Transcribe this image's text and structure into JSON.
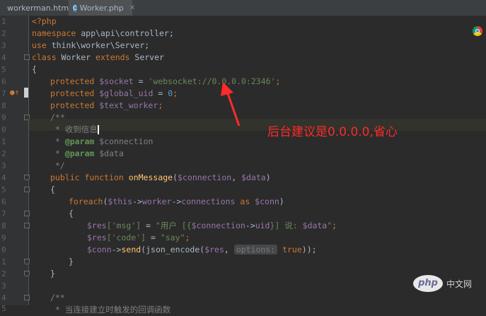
{
  "tabs": [
    {
      "label": "workerman.html",
      "icon": "html-file-icon",
      "active": false
    },
    {
      "label": "Worker.php",
      "icon": "php-file-icon",
      "active": true
    }
  ],
  "line_numbers": [
    "1",
    "2",
    "3",
    "4",
    "5",
    "6",
    "7",
    "8",
    "9",
    "0",
    "1",
    "2",
    "3",
    "4",
    "5",
    "6",
    "7",
    "8",
    "9",
    "0",
    "1",
    "2",
    "3",
    "4",
    "5"
  ],
  "code": {
    "l1": "<?php",
    "l2_kw": "namespace",
    "l2_rest": " app\\api\\controller;",
    "l3_kw": "use",
    "l3_rest": " think\\worker\\Server;",
    "l4_kw1": "class",
    "l4_name": " Worker ",
    "l4_kw2": "extends",
    "l4_name2": " Server",
    "l5": "{",
    "l6_kw": "protected",
    "l6_var": " $socket",
    "l6_eq": " = ",
    "l6_str": "'websocket://0.0.0.0:2346'",
    "l6_end": ";",
    "l7_kw": "protected",
    "l7_var": " $global_uid",
    "l7_eq": " = ",
    "l7_num": "0",
    "l7_end": ";",
    "l8_kw": "protected",
    "l8_var": " $text_worker",
    "l8_end": ";",
    "l9": "/**",
    "l10": " * 收到信息",
    "l11_star": " * ",
    "l11_tag": "@param",
    "l11_arg": " $connection",
    "l12_star": " * ",
    "l12_tag": "@param",
    "l12_arg": " $data",
    "l13": " */",
    "l14_kw1": "public",
    "l14_kw2": " function",
    "l14_fn": " onMessage",
    "l14_p1": "(",
    "l14_v1": "$connection",
    "l14_c": ", ",
    "l14_v2": "$data",
    "l14_p2": ")",
    "l15": "{",
    "l16_kw": "foreach",
    "l16_p": "(",
    "l16_v1": "$this",
    "l16_a1": "->",
    "l16_f1": "worker",
    "l16_a2": "->",
    "l16_f2": "connections",
    "l16_as": " as ",
    "l16_v2": "$conn",
    "l16_end": ")",
    "l17": "{",
    "l18_v": "$res",
    "l18_k": "['msg']",
    "l18_eq": " = ",
    "l18_s1": "\"用户 [{",
    "l18_v2": "$connection",
    "l18_a": "->",
    "l18_f": "uid",
    "l18_s2": "}] 说: ",
    "l18_v3": "$data",
    "l18_s3": "\"",
    "l18_end": ";",
    "l19_v": "$res",
    "l19_k": "['code']",
    "l19_eq": " = ",
    "l19_s": "\"say\"",
    "l19_end": ";",
    "l20_v": "$conn",
    "l20_a": "->",
    "l20_f": "send",
    "l20_p": "(json_encode(",
    "l20_v2": "$res",
    "l20_c": ", ",
    "l20_hint": "options:",
    "l20_kw": " true",
    "l20_end": "));",
    "l21": "}",
    "l22": "}",
    "l24": "/**",
    "l25": " * 当连接建立时触发的回调函数"
  },
  "annotation": "后台建议是0.0.0.0,省心",
  "watermark": {
    "logo": "php",
    "text": "中文网"
  },
  "colors": {
    "keyword": "#cc7832",
    "variable": "#9876aa",
    "string": "#6a8759",
    "annotation": "#ff2a2a"
  }
}
